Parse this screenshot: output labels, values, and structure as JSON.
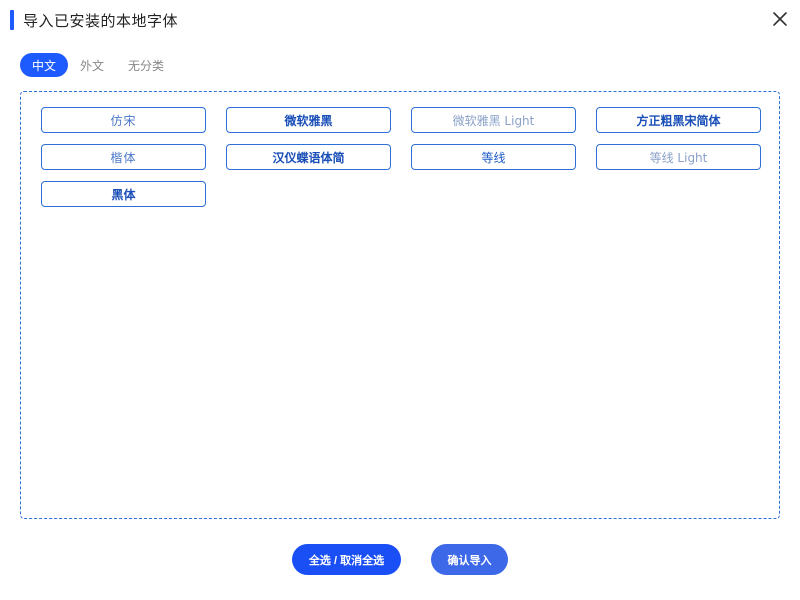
{
  "dialog": {
    "title": "导入已安装的本地字体",
    "close_icon": "close-icon",
    "accent_color": "#1e5bff"
  },
  "tabs": [
    {
      "label": "中文",
      "active": true
    },
    {
      "label": "外文",
      "active": false
    },
    {
      "label": "无分类",
      "active": false
    }
  ],
  "fonts": [
    {
      "label": "仿宋"
    },
    {
      "label": "微软雅黑"
    },
    {
      "label": "微软雅黑 Light"
    },
    {
      "label": "方正粗黑宋简体"
    },
    {
      "label": "楷体"
    },
    {
      "label": "汉仪蝶语体简"
    },
    {
      "label": "等线"
    },
    {
      "label": "等线 Light"
    },
    {
      "label": "黑体"
    }
  ],
  "actions": {
    "select_all_label": "全选 / 取消全选",
    "confirm_label": "确认导入"
  }
}
